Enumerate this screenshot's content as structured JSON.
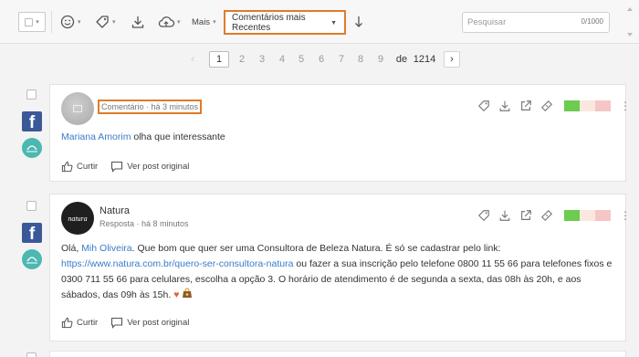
{
  "toolbar": {
    "mais_label": "Mais",
    "sort_selected": "Comentários mais Recentes",
    "search_placeholder": "Pesquisar",
    "search_count": "0/1000"
  },
  "pagination": {
    "pages": [
      "1",
      "2",
      "3",
      "4",
      "5",
      "6",
      "7",
      "8",
      "9"
    ],
    "current": "1",
    "of_label": "de",
    "total": "1214"
  },
  "posts": [
    {
      "meta": "Comentário · há 3 minutos",
      "mention": "Mariana Amorim",
      "text": " olha que interessante",
      "like_label": "Curtir",
      "view_label": "Ver post original"
    },
    {
      "author": "Natura",
      "sub": "Resposta · há 8 minutos",
      "avatar_text": "natura",
      "text_1": "Olá, ",
      "mention": "Mih Oliveira",
      "text_2": ". Que bom que quer ser uma Consultora de Beleza Natura. É só se cadastrar pelo link:",
      "link": "https://www.natura.com.br/quero-ser-consultora-natura",
      "text_3": " ou fazer a sua inscrição pelo telefone 0800 11 55 66 para telefones fixos e 0300 711 55 66 para celulares, escolha a opção 3. O horário de atendimento é de segunda a sexta, das 08h às 20h, e aos sábados, das 09h às 15h.",
      "like_label": "Curtir",
      "view_label": "Ver post original"
    }
  ],
  "colors": {
    "highlight": "#e07b2a",
    "link": "#3a7bc8",
    "positive": "#6dcc4e",
    "neutral": "#fae8de",
    "negative": "#f6c6c6"
  }
}
